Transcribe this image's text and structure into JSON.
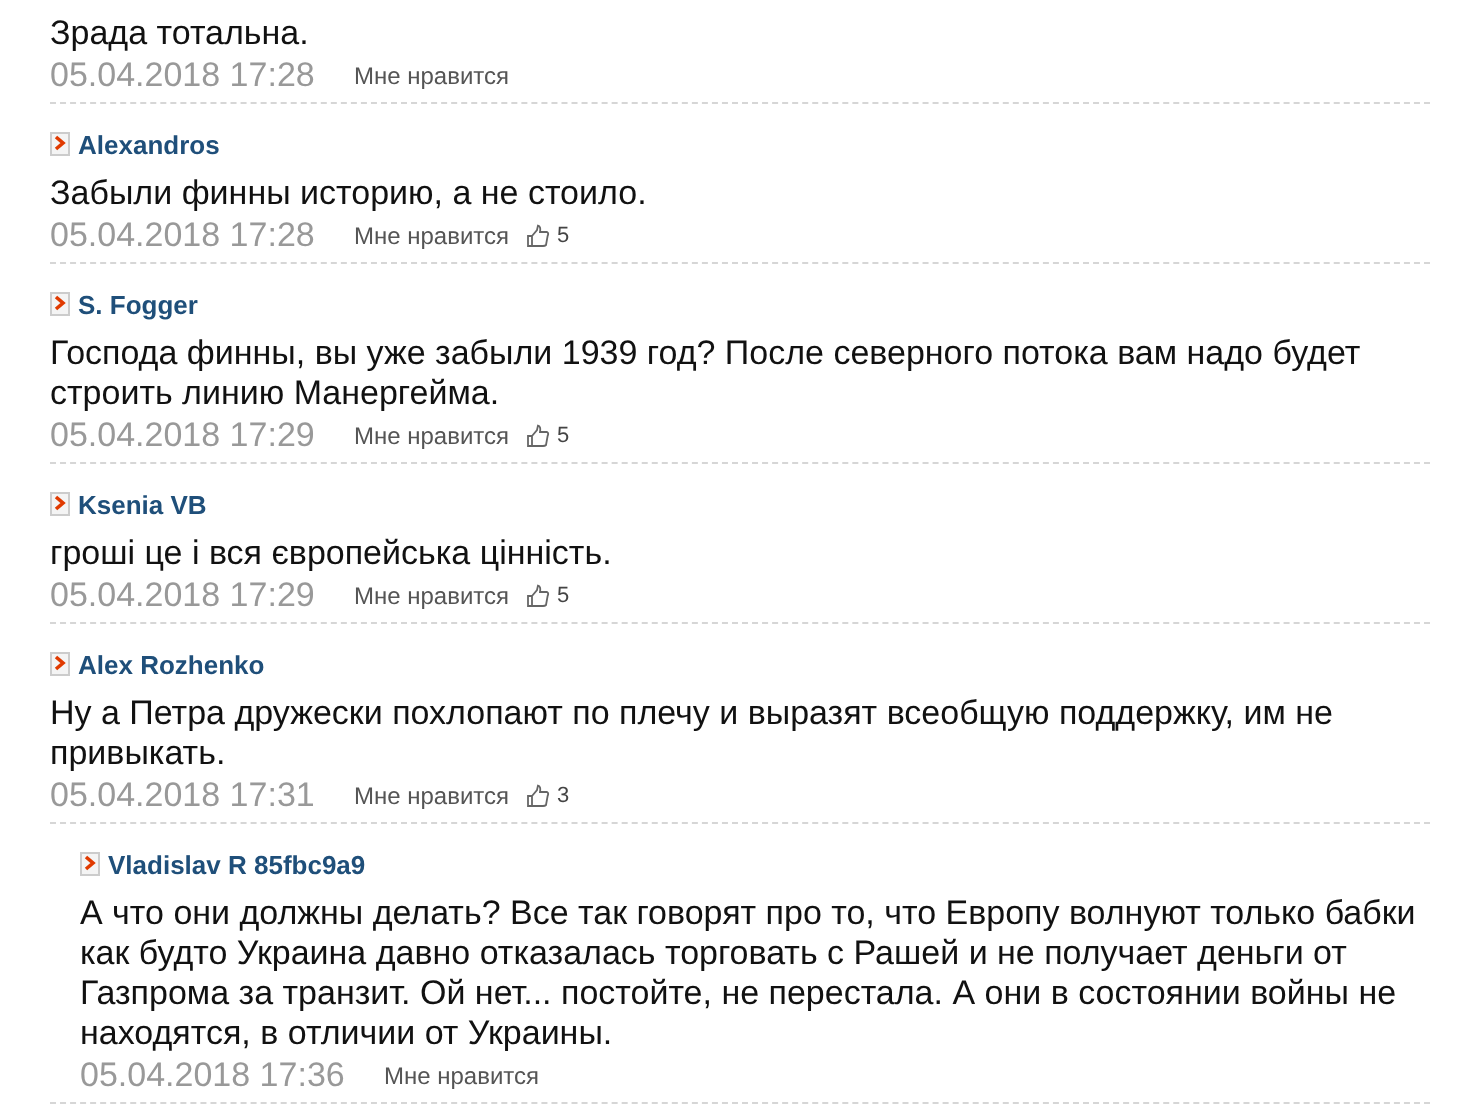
{
  "comments": [
    {
      "text": "Зрада тотальна.",
      "date": "05.04.2018 17:28",
      "like_label": "Мне нравится"
    },
    {
      "author": "Alexandros",
      "text": "Забыли финны историю, а не стоило.",
      "date": "05.04.2018 17:28",
      "like_label": "Мне нравится",
      "likes": "5"
    },
    {
      "author": "S. Fogger",
      "text": "Господа финны, вы уже забыли 1939 год? После северного потока вам надо будет строить линию Манергейма.",
      "date": "05.04.2018 17:29",
      "like_label": "Мне нравится",
      "likes": "5"
    },
    {
      "author": "Ksenia VB",
      "text": "гроші це і вся європейська цінність.",
      "date": "05.04.2018 17:29",
      "like_label": "Мне нравится",
      "likes": "5"
    },
    {
      "author": "Alex Rozhenko",
      "text": "Ну а Петра дружески похлопают по плечу и выразят всеобщую поддержку, им не привыкать.",
      "date": "05.04.2018 17:31",
      "like_label": "Мне нравится",
      "likes": "3",
      "children": [
        {
          "author": "Vladislav R 85fbc9a9",
          "text": "А что они должны делать? Все так говорят про то, что Европу волнуют только бабки как будто Украина давно отказалась торговать с Рашей и не получает деньги от Газпрома за транзит. Ой нет... постойте, не перестала. А они в состоянии войны не находятся, в отличии от Украины.",
          "date": "05.04.2018 17:36",
          "like_label": "Мне нравится"
        }
      ]
    }
  ]
}
